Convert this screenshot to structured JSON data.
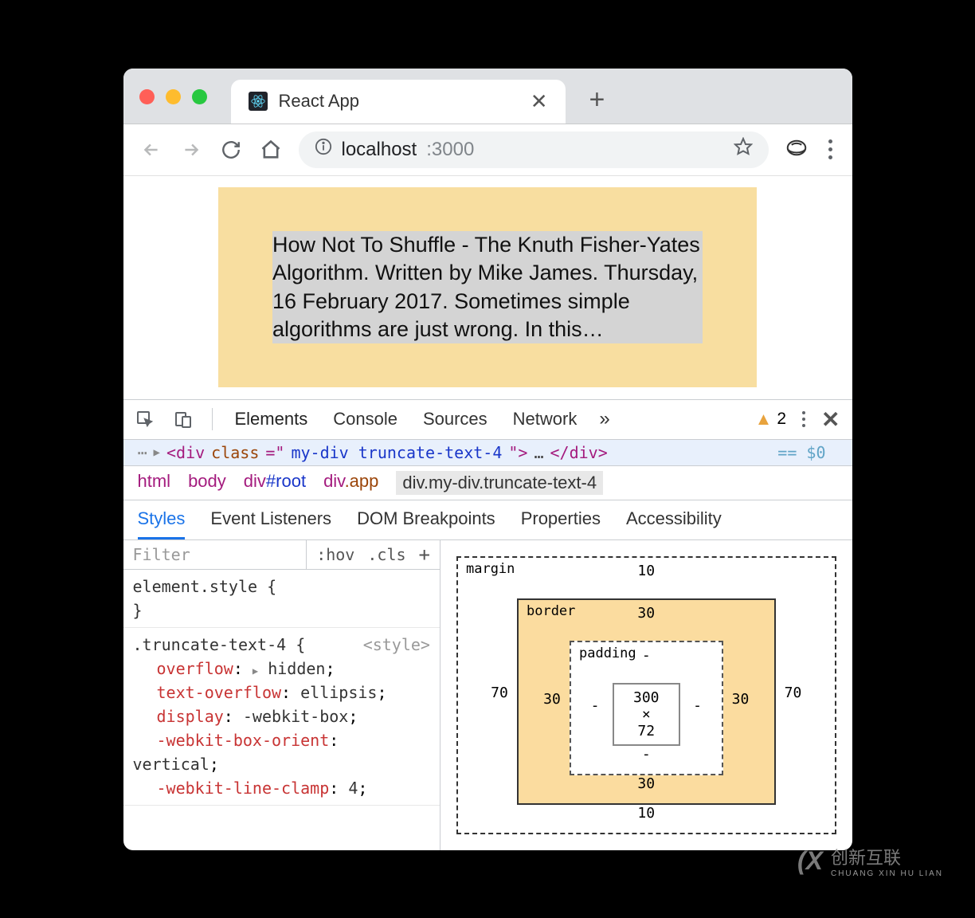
{
  "tab": {
    "title": "React App"
  },
  "url": {
    "host": "localhost",
    "port": ":3000"
  },
  "article_text": "How Not To Shuffle - The Knuth Fisher-Yates Algorithm. Written by Mike James. Thursday, 16 February 2017. Sometimes simple algorithms are just wrong. In this…",
  "devtools": {
    "tabs": [
      "Elements",
      "Console",
      "Sources",
      "Network"
    ],
    "warn_count": "2",
    "selected_html": {
      "tag_open": "<div",
      "attr_name": "class",
      "attr_val": "my-div truncate-text-4",
      "ell": "…",
      "tag_close": "</div>",
      "eq": "== $0"
    },
    "crumbs": [
      "html",
      "body",
      "div#root",
      "div.app",
      "div.my-div.truncate-text-4"
    ],
    "sub_tabs": [
      "Styles",
      "Event Listeners",
      "DOM Breakpoints",
      "Properties",
      "Accessibility"
    ],
    "filter_placeholder": "Filter",
    "hov": ":hov",
    "cls": ".cls",
    "rules": {
      "element_style": "element.style {",
      "element_close": "}",
      "truncate": {
        "selector": ".truncate-text-4 {",
        "source": "<style>",
        "props": [
          {
            "k": "overflow",
            "v": "hidden",
            "tri": true
          },
          {
            "k": "text-overflow",
            "v": "ellipsis"
          },
          {
            "k": "display",
            "v": "-webkit-box"
          },
          {
            "k": "-webkit-box-orient",
            "v": "vertical"
          },
          {
            "k": "-webkit-line-clamp",
            "v": "4"
          }
        ]
      }
    },
    "box_model": {
      "margin": {
        "label": "margin",
        "top": "10",
        "right": "70",
        "bottom": "10",
        "left": "70"
      },
      "border": {
        "label": "border",
        "top": "30",
        "right": "30",
        "bottom": "30",
        "left": "30"
      },
      "padding": {
        "label": "padding",
        "top": "-",
        "right": "-",
        "bottom": "-",
        "left": "-"
      },
      "content": "300 × 72"
    }
  },
  "watermark": {
    "brand": "创新互联",
    "sub": "CHUANG XIN HU LIAN"
  }
}
